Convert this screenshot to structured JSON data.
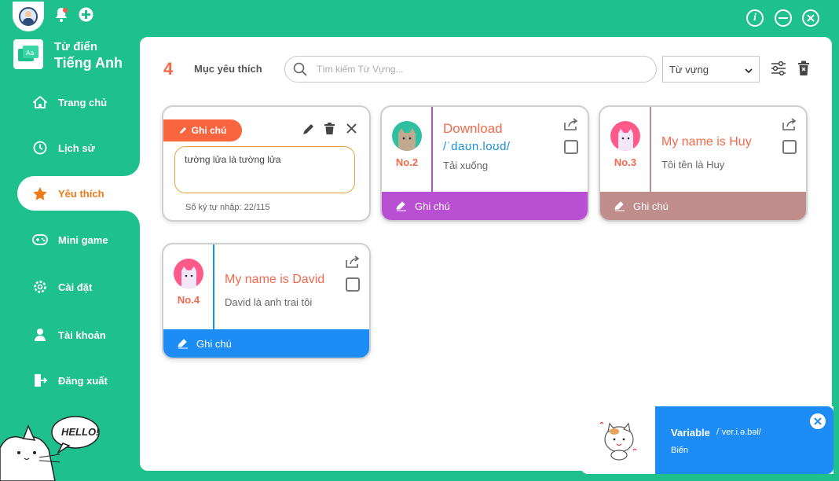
{
  "app": {
    "title_line1": "Từ điển",
    "title_line2": "Tiếng Anh",
    "accent": "#1ec08c"
  },
  "sidebar": {
    "items": [
      {
        "label": "Trang chủ",
        "icon": "home-icon"
      },
      {
        "label": "Lịch sử",
        "icon": "history-icon"
      },
      {
        "label": "Yêu thích",
        "icon": "star-icon",
        "active": true
      },
      {
        "label": "Mini game",
        "icon": "gamepad-icon"
      },
      {
        "label": "Cài đặt",
        "icon": "gear-icon"
      },
      {
        "label": "Tài khoản",
        "icon": "user-icon"
      },
      {
        "label": "Đăng xuất",
        "icon": "logout-icon"
      }
    ],
    "mascot_text": "HELLO!"
  },
  "header": {
    "count": "4",
    "label": "Mục yêu thích",
    "search_placeholder": "Tìm kiếm Từ Vựng...",
    "filter_selected": "Từ vựng"
  },
  "edit_card": {
    "tag_label": "Ghi chú",
    "note_text": "tường lửa là tường lửa",
    "char_count": "Số ký tự nhập: 22/115"
  },
  "cards": [
    {
      "no": "No.2",
      "word": "Download",
      "ipa": "/ˈdaʊn.loʊd/",
      "meaning": "Tải xuống",
      "note_label": "Ghi chú",
      "bar_color": "#b94fd3"
    },
    {
      "no": "No.3",
      "word": "My name is Huy",
      "ipa": "",
      "meaning": "Tôi tên là Huy",
      "note_label": "Ghi chú",
      "bar_color": "#c08d8d"
    },
    {
      "no": "No.4",
      "word": "My name is David",
      "ipa": "",
      "meaning": "David là anh trai tôi",
      "note_label": "Ghi chú",
      "bar_color": "#1e8cf5"
    }
  ],
  "toast": {
    "word": "Variable",
    "ipa": "/ˈver.i.ə.bəl/",
    "meaning": "Biến"
  }
}
